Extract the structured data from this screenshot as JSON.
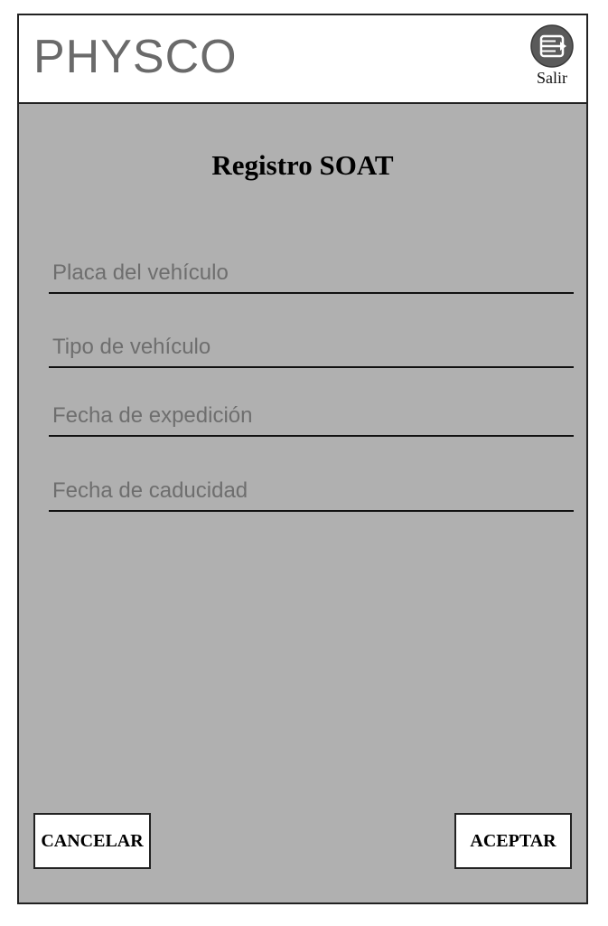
{
  "header": {
    "brand": "PHYSCO",
    "logout": {
      "icon": "exit-icon",
      "label": "Salir",
      "icon_color": "#5a5a5a"
    }
  },
  "form": {
    "title": "Registro SOAT",
    "fields": [
      {
        "placeholder": "Placa del vehículo",
        "value": ""
      },
      {
        "placeholder": "Tipo de vehículo",
        "value": ""
      },
      {
        "placeholder": "Fecha de expedición",
        "value": ""
      },
      {
        "placeholder": "Fecha de caducidad",
        "value": ""
      }
    ]
  },
  "actions": {
    "cancel_label": "CANCELAR",
    "accept_label": "ACEPTAR"
  },
  "colors": {
    "panel_background": "#b0b0b0",
    "header_background": "#ffffff",
    "brand_text": "#6a6a6a"
  }
}
